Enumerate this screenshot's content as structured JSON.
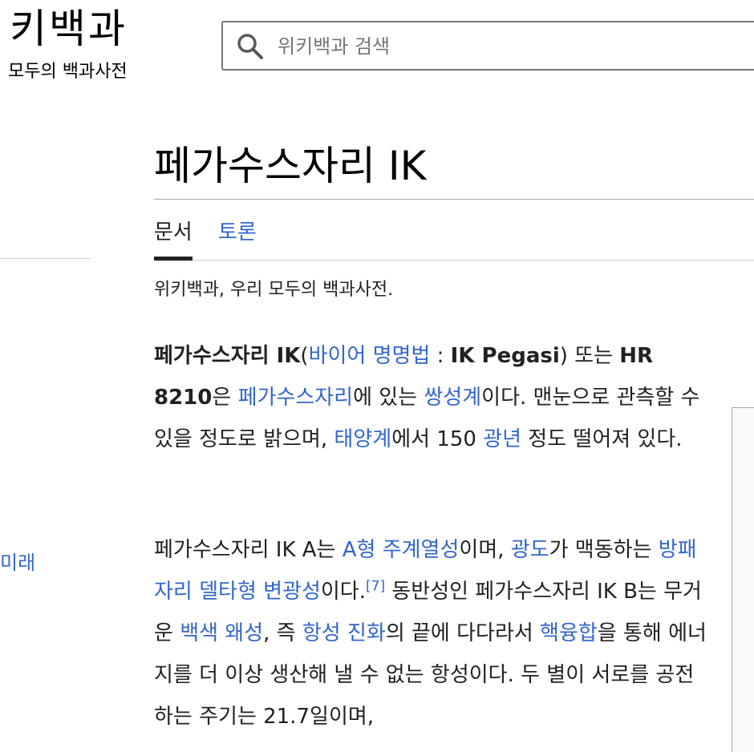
{
  "header": {
    "logo_word": "키백과",
    "logo_tagline": "모두의 백과사전",
    "search_placeholder": "위키백과 검색"
  },
  "sidebar": {
    "partial_link": "미래"
  },
  "article": {
    "title": "페가수스자리 IK",
    "tabs": [
      {
        "label": "문서",
        "active": true
      },
      {
        "label": "토론",
        "active": false
      }
    ],
    "site_sub": "위키백과, 우리 모두의 백과사전.",
    "p1": {
      "b1": "페가수스자리 IK",
      "t1": "(",
      "l1": "바이어 명명법",
      "t2": " : ",
      "b2": "IK Pegasi",
      "t3": ") 또는 ",
      "b3": "HR 8210",
      "t4": "은 ",
      "l2": "페가수스자리",
      "t5": "에 있는 ",
      "l3": "쌍성계",
      "t6": "이다. 맨눈으로 관측할 수 있을 정도로 밝으며, ",
      "l4": "태양계",
      "t7": "에서 150 ",
      "l5": "광년",
      "t8": " 정도 떨어져 있다."
    },
    "p2": {
      "t1": "페가수스자리 IK A는 ",
      "l1": "A형 주계열성",
      "t2": "이며, ",
      "l2": "광도",
      "t3": "가 맥동하는 ",
      "l3": "방패자리 델타형 변광성",
      "t4": "이다.",
      "ref1": "[7]",
      "t5": " 동반성인 페가수스자리 IK B는 무거운 ",
      "l4": "백색 왜성",
      "t6": ", 즉 ",
      "l5": "항성 진화",
      "t7": "의 끝에 다다라서 ",
      "l6": "핵융합",
      "t8": "을 통해 에너지를 더 이상 생산해 낼 수 없는 항성이다. 두 별이 서로를 공전하는 주기는 21.7일이며,"
    }
  }
}
